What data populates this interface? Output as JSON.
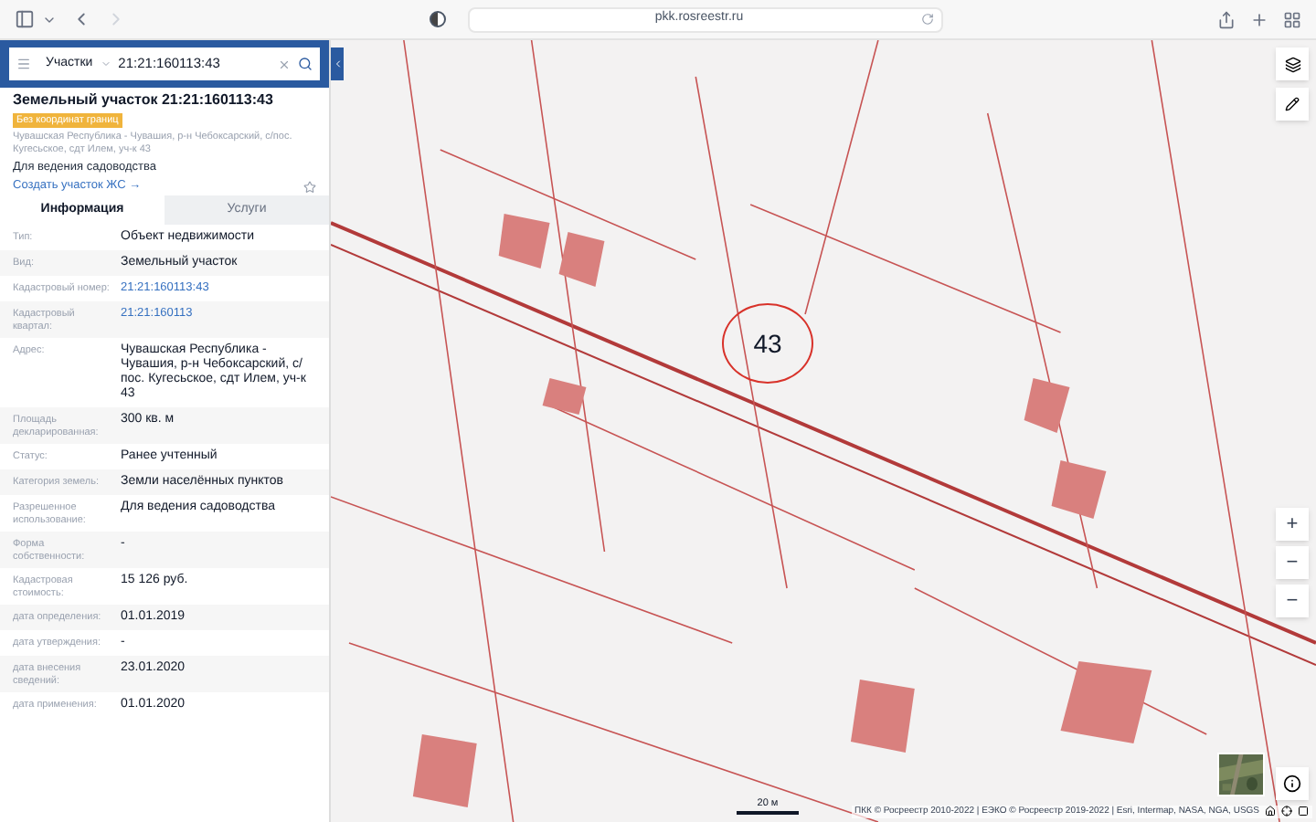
{
  "browser": {
    "url": "pkk.rosreestr.ru"
  },
  "search": {
    "layer": "Участки",
    "value": "21:21:160113:43"
  },
  "parcel": {
    "title": "Земельный участок 21:21:160113:43",
    "badge": "Без координат границ",
    "address": "Чувашская Республика - Чувашия, р-н Чебоксарский, с/пос. Кугесьское, сдт Илем, уч-к 43",
    "purpose": "Для ведения садоводства",
    "create_link": "Создать участок ЖС →"
  },
  "tabs": [
    {
      "label": "Информация",
      "selected": true
    },
    {
      "label": "Услуги",
      "selected": false
    }
  ],
  "rows": [
    {
      "label": "Тип:",
      "value": "Объект недвижимости",
      "kind": "text"
    },
    {
      "label": "Вид:",
      "value": "Земельный участок",
      "kind": "text"
    },
    {
      "label": "Кадастровый номер:",
      "value": "21:21:160113:43",
      "kind": "link"
    },
    {
      "label": "Кадастровый квартал:",
      "value": "21:21:160113",
      "kind": "link"
    },
    {
      "label": "Адрес:",
      "value": "Чувашская Республика - Чувашия, р-н Чебоксарский, с/пос. Кугесьское, сдт Илем, уч-к 43",
      "kind": "text"
    },
    {
      "label": "Площадь декларированная:",
      "value": "300 кв. м",
      "kind": "text"
    },
    {
      "label": "Статус:",
      "value": "Ранее учтенный",
      "kind": "text"
    },
    {
      "label": "Категория земель:",
      "value": "Земли населённых пунктов",
      "kind": "text"
    },
    {
      "label": "Разрешенное использование:",
      "value": "Для ведения садоводства",
      "kind": "text"
    },
    {
      "label": "Форма собственности:",
      "value": "-",
      "kind": "text"
    },
    {
      "label": "Кадастровая стоимость:",
      "value": "15 126 руб.",
      "kind": "text"
    },
    {
      "label": "дата определения:",
      "value": "01.01.2019",
      "kind": "text"
    },
    {
      "label": "дата утверждения:",
      "value": "-",
      "kind": "text"
    },
    {
      "label": "дата внесения сведений:",
      "value": "23.01.2020",
      "kind": "text"
    },
    {
      "label": "дата применения:",
      "value": "01.01.2020",
      "kind": "text"
    }
  ],
  "map": {
    "annotation": "43",
    "scale": "20 м",
    "attribution": "ПКК © Росреестр 2010-2022 | ЕЭКО © Росреестр 2019-2022 | Esri, Intermap, NASA, NGA, USGS",
    "zoom_buttons": [
      "+",
      "−",
      "−"
    ]
  }
}
